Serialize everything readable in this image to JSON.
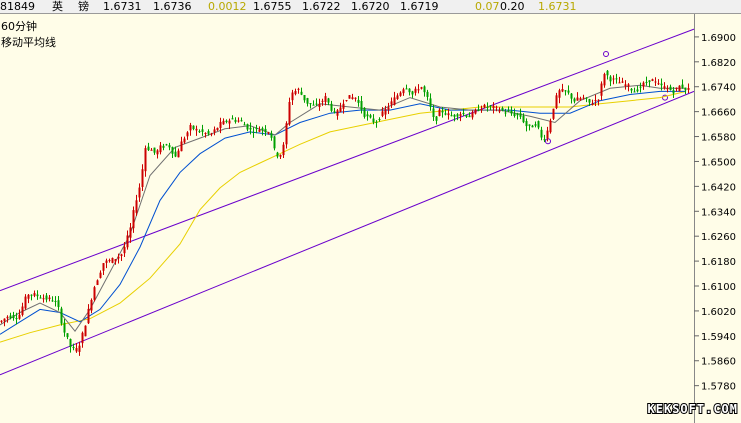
{
  "quote_bar": {
    "code": "81849",
    "symbol": "英",
    "symbol2": "镑",
    "price_a": "1.6731",
    "price_b": "1.6736",
    "change": "0.0012",
    "high": "1.6755",
    "low": "1.6722",
    "val_a": "1.6720",
    "val_b": "1.6719",
    "val_c": "0.07",
    "val_d": "0.20",
    "last": "1.6731"
  },
  "colors": {
    "background": "#fffde8",
    "up_candle": "#cc0000",
    "down_candle": "#00a000",
    "channel": "#6a00cc",
    "ma_short": "#707070",
    "ma_mid": "#0050d0",
    "ma_long": "#e8d000",
    "highlight": "#d0c000"
  },
  "chart_data": {
    "type": "line",
    "title": "60分钟",
    "subtitle": "移动平均线",
    "ylim": [
      1.575,
      1.6935
    ],
    "y_ticks": [
      "1.6900",
      "1.6820",
      "1.6740",
      "1.6660",
      "1.6580",
      "1.6500",
      "1.6420",
      "1.6340",
      "1.6260",
      "1.6180",
      "1.6100",
      "1.6020",
      "1.5940",
      "1.5860",
      "1.5780"
    ],
    "watermark": "KEKSOFT.COM",
    "series": [
      {
        "role": "price",
        "x": [
          0,
          8,
          18,
          27,
          36,
          45,
          53,
          57,
          63,
          70,
          75,
          80,
          85,
          93,
          103,
          113,
          122,
          130,
          135,
          140,
          145,
          150,
          155,
          160,
          168,
          175,
          180,
          190,
          200,
          210,
          220,
          230,
          240,
          250,
          260,
          270,
          275,
          282,
          286,
          290,
          298,
          306,
          315,
          325,
          335,
          345,
          355,
          365,
          375,
          385,
          395,
          405,
          412,
          420,
          428,
          434,
          440,
          450,
          460,
          470,
          480,
          490,
          500,
          510,
          520,
          528,
          536,
          542,
          548,
          552,
          558,
          566,
          574,
          582,
          590,
          598,
          604,
          610,
          618,
          626,
          634,
          642,
          650,
          658,
          666,
          674,
          680,
          686
        ],
        "y": [
          1.5985,
          1.6005,
          1.6,
          1.6075,
          1.607,
          1.606,
          1.6055,
          1.604,
          1.596,
          1.5905,
          1.589,
          1.592,
          1.598,
          1.609,
          1.6175,
          1.6185,
          1.6205,
          1.6285,
          1.637,
          1.643,
          1.6545,
          1.654,
          1.6525,
          1.6545,
          1.6555,
          1.6515,
          1.6555,
          1.661,
          1.6595,
          1.6585,
          1.662,
          1.6635,
          1.663,
          1.66,
          1.6605,
          1.6595,
          1.652,
          1.6525,
          1.662,
          1.672,
          1.673,
          1.669,
          1.6675,
          1.6705,
          1.6645,
          1.6705,
          1.6705,
          1.6645,
          1.6625,
          1.6665,
          1.6705,
          1.6745,
          1.6715,
          1.6745,
          1.6695,
          1.6625,
          1.6665,
          1.6645,
          1.6655,
          1.6645,
          1.6675,
          1.6675,
          1.6665,
          1.6655,
          1.6645,
          1.6605,
          1.6625,
          1.6565,
          1.6605,
          1.6665,
          1.6725,
          1.6725,
          1.6695,
          1.6705,
          1.6685,
          1.6705,
          1.6785,
          1.6765,
          1.6755,
          1.6745,
          1.6725,
          1.6745,
          1.6765,
          1.6745,
          1.6735,
          1.6725,
          1.6745,
          1.6731
        ]
      },
      {
        "role": "ma_short",
        "x": [
          0,
          20,
          40,
          60,
          75,
          90,
          110,
          130,
          150,
          175,
          200,
          225,
          250,
          275,
          290,
          320,
          350,
          380,
          410,
          440,
          470,
          500,
          530,
          555,
          580,
          610,
          640,
          660,
          686
        ],
        "y": [
          1.5975,
          1.6015,
          1.6045,
          1.6015,
          1.5955,
          1.6025,
          1.6145,
          1.6265,
          1.6455,
          1.6545,
          1.6575,
          1.6605,
          1.6615,
          1.6585,
          1.6625,
          1.6685,
          1.6675,
          1.6665,
          1.6705,
          1.6675,
          1.6665,
          1.6665,
          1.6645,
          1.6625,
          1.6695,
          1.6735,
          1.6745,
          1.6735,
          1.6735
        ]
      },
      {
        "role": "ma_mid",
        "x": [
          0,
          20,
          40,
          60,
          80,
          100,
          120,
          140,
          160,
          180,
          200,
          225,
          250,
          275,
          300,
          330,
          360,
          390,
          420,
          450,
          480,
          510,
          540,
          570,
          600,
          630,
          660,
          686
        ],
        "y": [
          1.5945,
          1.5985,
          1.6025,
          1.6015,
          1.5985,
          1.6025,
          1.6105,
          1.6225,
          1.6375,
          1.6465,
          1.6525,
          1.6575,
          1.6595,
          1.6585,
          1.6625,
          1.6655,
          1.6665,
          1.6665,
          1.6685,
          1.6665,
          1.6665,
          1.6665,
          1.6655,
          1.6655,
          1.6695,
          1.6715,
          1.6725,
          1.6725
        ]
      },
      {
        "role": "ma_long",
        "x": [
          0,
          30,
          60,
          90,
          120,
          150,
          180,
          200,
          220,
          240,
          260,
          280,
          300,
          330,
          360,
          390,
          420,
          450,
          480,
          510,
          540,
          570,
          600,
          630,
          660,
          686
        ],
        "y": [
          1.592,
          1.595,
          1.5975,
          1.5995,
          1.6045,
          1.6125,
          1.6235,
          1.6345,
          1.6415,
          1.6465,
          1.6495,
          1.6525,
          1.6555,
          1.6595,
          1.6615,
          1.6635,
          1.6655,
          1.6665,
          1.6675,
          1.6675,
          1.6675,
          1.6675,
          1.6685,
          1.6695,
          1.6705,
          1.6725
        ]
      },
      {
        "role": "channel_upper",
        "x": [
          0,
          694
        ],
        "y": [
          1.6085,
          1.6925
        ]
      },
      {
        "role": "channel_lower",
        "x": [
          0,
          694
        ],
        "y": [
          1.5815,
          1.6725
        ]
      }
    ]
  }
}
